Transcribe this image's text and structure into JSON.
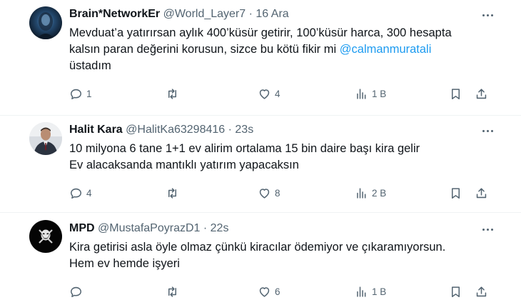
{
  "tweets": [
    {
      "name": "Brain*NetworkEr",
      "handle": "@World_Layer7",
      "separator": "·",
      "time": "16 Ara",
      "line1": "Mevduat’a yatırırsan aylık 400’küsür getirir, 100’küsür harca, 300 hesapta",
      "line2_text": "kalsın paran değerini korusun, sizce bu kötü fikir mi ",
      "line2_mention": "@calmanmuratali",
      "line3": "üstadım",
      "replies": "1",
      "retweets": "",
      "likes": "4",
      "views": "1 B"
    },
    {
      "name": "Halit Kara",
      "handle": "@HalitKa63298416",
      "separator": "·",
      "time": "23s",
      "line1": "10 milyona 6 tane 1+1 ev alirim ortalama 15 bin daire başı kira gelir",
      "line2": "Ev alacaksanda mantıklı yatırım yapacaksın",
      "replies": "4",
      "retweets": "",
      "likes": "8",
      "views": "2 B"
    },
    {
      "name": "MPD",
      "handle": "@MustafaPoyrazD1",
      "separator": "·",
      "time": "22s",
      "line1": "Kira getirisi asla öyle olmaz çünkü kiracılar ödemiyor ve çıkaramıyorsun.",
      "line2": "Hem ev hemde işyeri",
      "replies": "",
      "retweets": "",
      "likes": "6",
      "views": "1 B"
    }
  ],
  "icons": {
    "reply": "reply-icon",
    "retweet": "retweet-icon",
    "like": "heart-icon",
    "views": "views-icon",
    "bookmark": "bookmark-icon",
    "share": "share-icon",
    "more": "more-icon"
  },
  "colors": {
    "mention": "#1d9bf0",
    "secondary_text": "#536471",
    "divider": "#eff3f4"
  }
}
